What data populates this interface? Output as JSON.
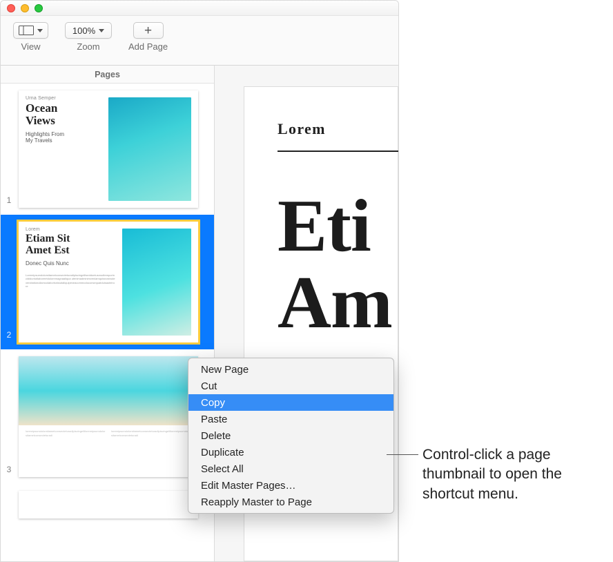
{
  "toolbar": {
    "view_label": "View",
    "zoom_value": "100%",
    "zoom_label": "Zoom",
    "add_page_label": "Add Page"
  },
  "sidebar": {
    "title": "Pages",
    "pages": [
      {
        "num": "1",
        "kicker": "Urna Semper",
        "title": "Ocean\nViews",
        "sub": "Highlights From\nMy Travels"
      },
      {
        "num": "2",
        "kicker": "Lorem",
        "title": "Etiam Sit\nAmet Est",
        "sub": "Donec Quis Nunc"
      },
      {
        "num": "3"
      }
    ]
  },
  "canvas": {
    "eyebrow": "Lorem",
    "title_l1": "Eti",
    "title_l2": "Am"
  },
  "context_menu": {
    "items": [
      "New Page",
      "Cut",
      "Copy",
      "Paste",
      "Delete",
      "Duplicate",
      "Select All",
      "Edit Master Pages…",
      "Reapply Master to Page"
    ],
    "highlighted_index": 2
  },
  "callout": "Control-click a page thumbnail to open the shortcut menu."
}
